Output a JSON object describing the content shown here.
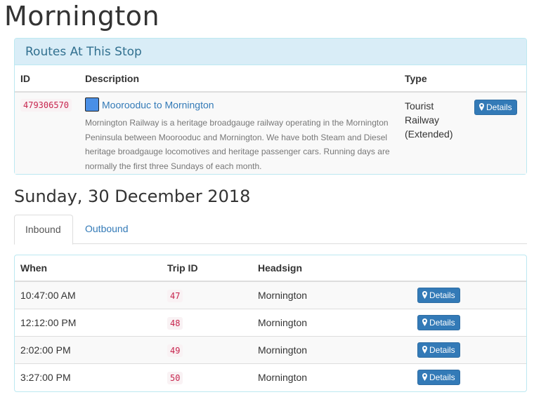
{
  "page": {
    "title": "Mornington"
  },
  "routes_panel": {
    "heading": "Routes At This Stop",
    "columns": {
      "id": "ID",
      "description": "Description",
      "type": "Type"
    },
    "rows": [
      {
        "id": "479306570",
        "route_color": "#4a8fe6",
        "name": "Moorooduc to Mornington",
        "description": "Mornington Railway is a heritage broadgauge railway operating in the Mornington Peninsula between Moorooduc and Mornington. We have both Steam and Diesel heritage broadgauge locomotives and heritage passenger cars. Running days are normally the first three Sundays of each month.",
        "type_line1": "Tourist",
        "type_line2": "Railway",
        "type_line3": "(Extended)",
        "details_label": "Details",
        "details_icon": "map-marker-icon"
      }
    ]
  },
  "date_heading": "Sunday, 30 December 2018",
  "tabs": [
    {
      "label": "Inbound",
      "active": true
    },
    {
      "label": "Outbound",
      "active": false
    }
  ],
  "trips_panel": {
    "columns": {
      "when": "When",
      "trip_id": "Trip ID",
      "headsign": "Headsign"
    },
    "rows": [
      {
        "when": "10:47:00 AM",
        "trip_id": "47",
        "headsign": "Mornington",
        "details_label": "Details"
      },
      {
        "when": "12:12:00 PM",
        "trip_id": "48",
        "headsign": "Mornington",
        "details_label": "Details"
      },
      {
        "when": "2:02:00 PM",
        "trip_id": "49",
        "headsign": "Mornington",
        "details_label": "Details"
      },
      {
        "when": "3:27:00 PM",
        "trip_id": "50",
        "headsign": "Mornington",
        "details_label": "Details"
      }
    ]
  },
  "colors": {
    "info_heading_bg": "#d9edf7",
    "info_heading_text": "#31708f",
    "info_border": "#bce8f1",
    "primary_button": "#337ab7",
    "code_text": "#c7254e",
    "link": "#337ab7"
  }
}
